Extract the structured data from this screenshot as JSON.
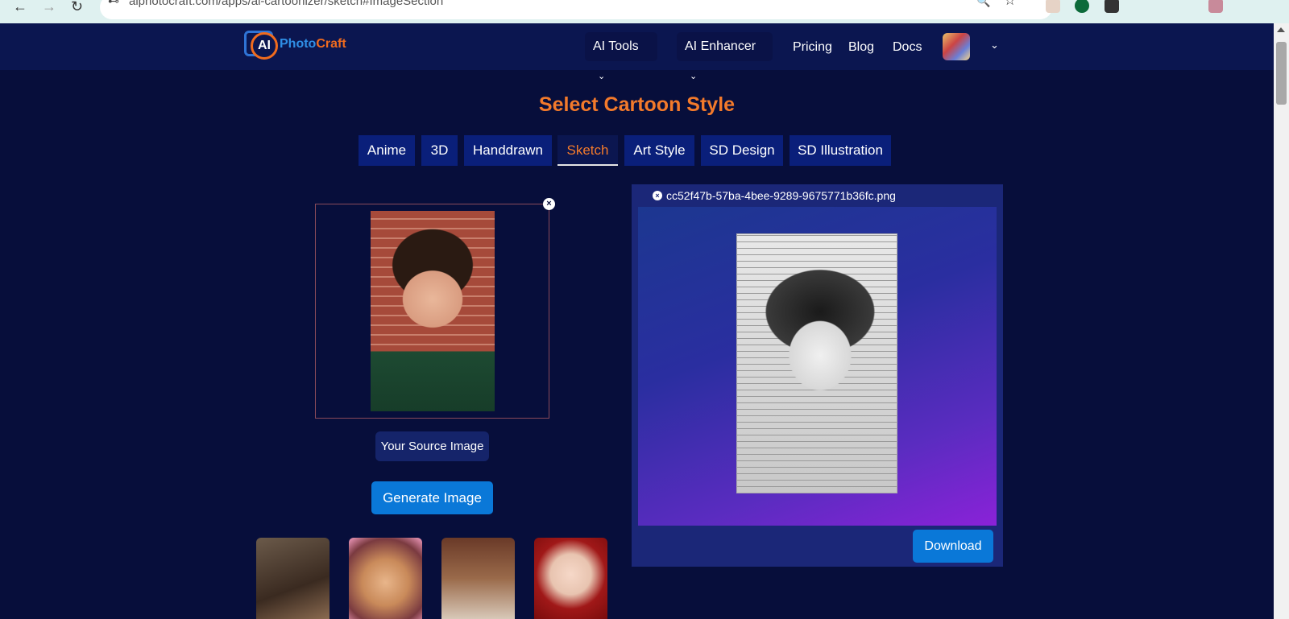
{
  "browser": {
    "url": "aiphotocraft.com/apps/ai-cartoonizer/sketch#ImageSection",
    "back_icon": "←",
    "forward_icon": "→",
    "reload_icon": "↻",
    "tune_icon": "⊷",
    "zoom_icon": "🔍",
    "star_icon": "☆"
  },
  "header": {
    "logo_ai": "AI",
    "logo_photo": "Photo",
    "logo_craft": "Craft",
    "menu": {
      "ai_tools": "AI Tools",
      "ai_enhancer": "AI Enhancer",
      "pricing": "Pricing",
      "blog": "Blog",
      "docs": "Docs"
    },
    "chevron": "⌄"
  },
  "main": {
    "title": "Select Cartoon Style",
    "tabs": [
      {
        "label": "Anime"
      },
      {
        "label": "3D"
      },
      {
        "label": "Handdrawn"
      },
      {
        "label": "Sketch"
      },
      {
        "label": "Art Style"
      },
      {
        "label": "SD Design"
      },
      {
        "label": "SD Illustration"
      }
    ],
    "active_tab": "Sketch",
    "source_label": "Your Source Image",
    "generate_label": "Generate Image",
    "close_glyph": "×"
  },
  "result": {
    "filename": "cc52f47b-57ba-4bee-9289-9675771b36fc.png",
    "download_label": "Download"
  },
  "colors": {
    "page_bg": "#070e3b",
    "header_bg": "#0b1650",
    "accent_orange": "#f37a2b",
    "button_blue": "#0a78d8",
    "tab_bg": "#0a1f7a"
  }
}
